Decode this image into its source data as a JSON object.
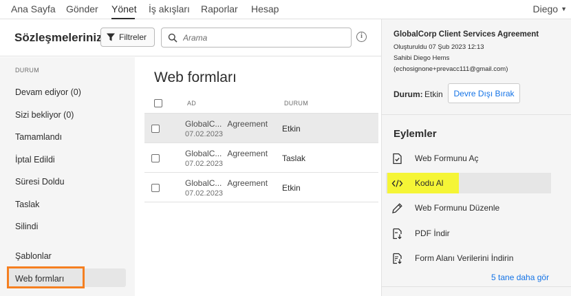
{
  "nav": {
    "items": [
      "Ana Sayfa",
      "Gönder",
      "Yönet",
      "İş akışları",
      "Raporlar",
      "Hesap"
    ],
    "active": "Yönet",
    "user": "Diego"
  },
  "toolbar": {
    "title": "Sözleşmeleriniz",
    "filter_label": "Filtreler",
    "search_placeholder": "Arama"
  },
  "sidebar": {
    "heading": "DURUM",
    "items": [
      "Devam ediyor (0)",
      "Sizi bekliyor (0)",
      "Tamamlandı",
      "İptal Edildi",
      "Süresi Doldu",
      "Taslak",
      "Silindi"
    ],
    "extra": [
      "Şablonlar",
      "Web formları"
    ],
    "selected": "Web formları"
  },
  "list": {
    "title": "Web formları",
    "columns": [
      "AD",
      "DURUM"
    ],
    "rows": [
      {
        "name_a": "GlobalC...",
        "name_b": "Agreement",
        "date": "07.02.2023",
        "status": "Etkin"
      },
      {
        "name_a": "GlobalC...",
        "name_b": "Agreement",
        "date": "07.02.2023",
        "status": "Taslak"
      },
      {
        "name_a": "GlobalC...",
        "name_b": "Agreement",
        "date": "07.02.2023",
        "status": "Etkin"
      }
    ]
  },
  "details": {
    "title": "GlobalCorp Client Services Agreement",
    "created": "Oluşturuldu 07 Şub 2023 12:13",
    "owner": "Sahibi Diego Hems",
    "email": "(echosignone+prevacc111@gmail.com)",
    "status_label": "Durum:",
    "status_value": "Etkin",
    "disable_button": "Devre Dışı Bırak",
    "actions_heading": "Eylemler",
    "actions": [
      {
        "label": "Web Formunu Aç",
        "icon": "document-check-icon"
      },
      {
        "label": "Kodu Al",
        "icon": "code-icon"
      },
      {
        "label": "Web Formunu Düzenle",
        "icon": "pencil-icon"
      },
      {
        "label": "PDF İndir",
        "icon": "pdf-download-icon"
      },
      {
        "label": "Form Alanı Verilerini İndirin",
        "icon": "data-download-icon"
      }
    ],
    "more_link": "5 tane daha gör"
  },
  "colors": {
    "accent_blue": "#1473e6",
    "highlight_yellow": "#f5f536",
    "callout_orange": "#f57f20"
  }
}
